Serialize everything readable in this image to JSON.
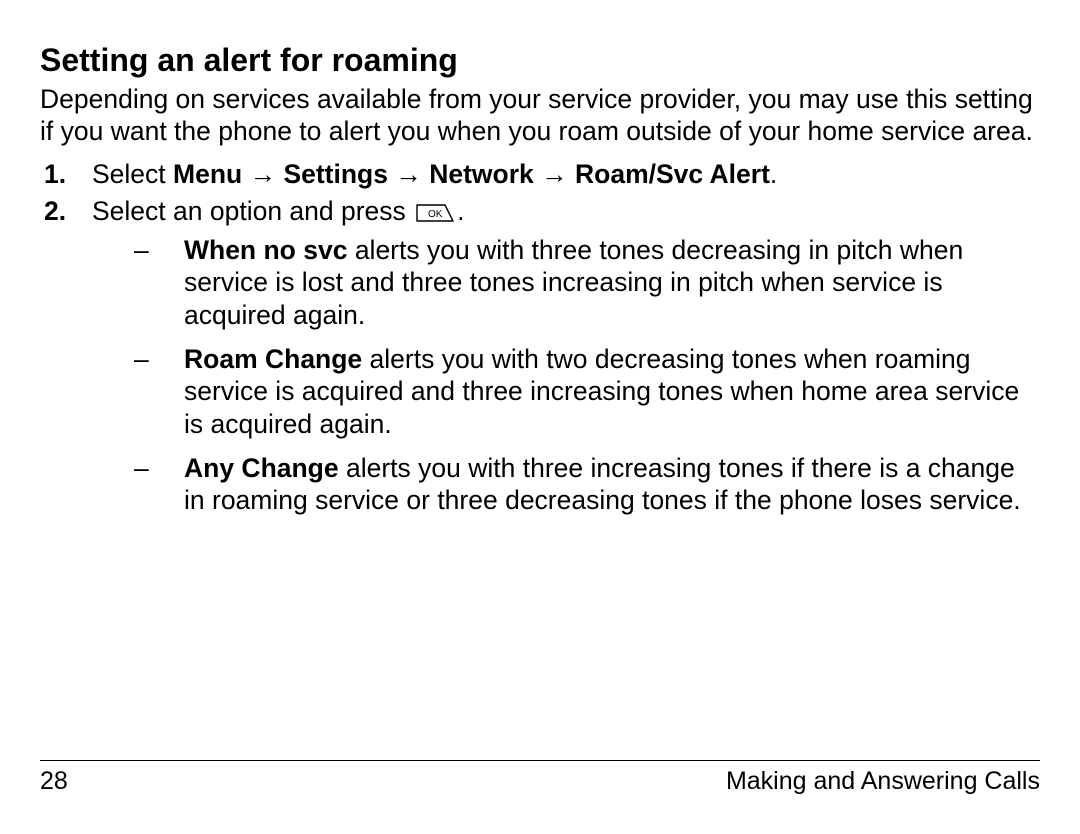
{
  "heading": "Setting an alert for roaming",
  "intro": "Depending on services available from your service provider, you may use this setting if you want the phone to alert you when you roam outside of your home service area.",
  "step1": {
    "prefix": "Select ",
    "menu": "Menu",
    "settings": "Settings",
    "network": "Network",
    "roam": "Roam/Svc Alert",
    "arrow": " → "
  },
  "step2": {
    "prefix": "Select an option and press ",
    "suffix": "."
  },
  "options": [
    {
      "label": "When no svc",
      "text": " alerts you with three tones decreasing in pitch when service is lost and three tones increasing in pitch when service is acquired again."
    },
    {
      "label": "Roam Change",
      "text": " alerts you with two decreasing tones when roaming service is acquired and three increasing tones when home area service is acquired again."
    },
    {
      "label": "Any Change",
      "text": " alerts you with three increasing tones if there is a change in roaming service or three decreasing tones if the phone loses service."
    }
  ],
  "footer": {
    "page": "28",
    "chapter": "Making and Answering Calls"
  },
  "icon": {
    "ok_label": "OK"
  }
}
